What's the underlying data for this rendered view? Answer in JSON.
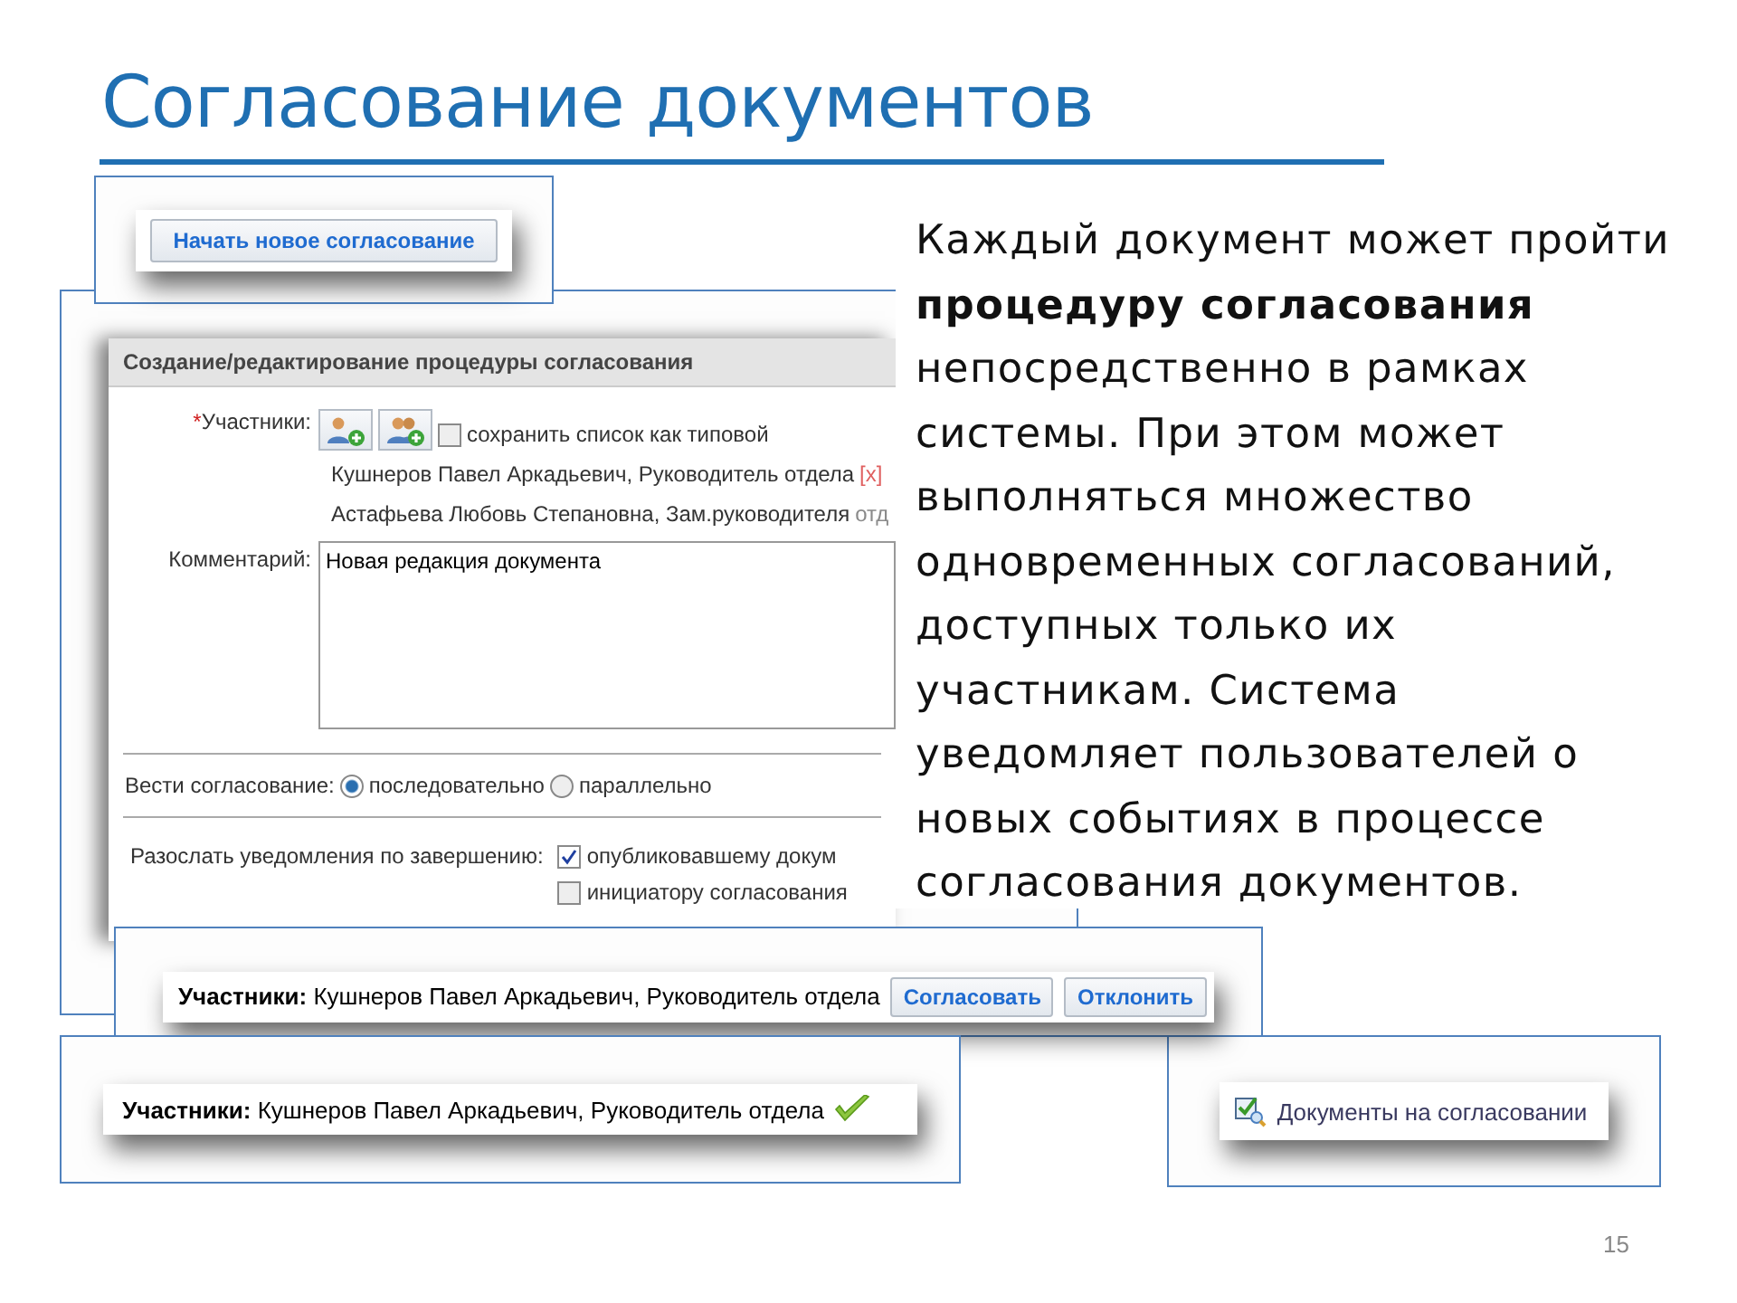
{
  "slide": {
    "title": "Согласование документов",
    "page_number": "15"
  },
  "start_panel": {
    "button": "Начать новое согласование"
  },
  "form": {
    "header": "Создание/редактирование процедуры согласования",
    "required_mark": "*",
    "participants_label": "Участники:",
    "save_checkbox": {
      "label": "сохранить список как типовой",
      "checked": false
    },
    "participants": [
      {
        "text": "Кушнеров Павел Аркадьевич, Руководитель отдела",
        "remove": "[x]"
      },
      {
        "text": "Астафьева Любовь Степановна, Зам.руководителя",
        "remove": "отд"
      }
    ],
    "comment_label": "Комментарий:",
    "comment_value": "Новая редакция документа",
    "mode_label": "Вести согласование:",
    "mode_options": [
      {
        "label": "последовательно",
        "selected": true
      },
      {
        "label": "параллельно",
        "selected": false
      }
    ],
    "notify_label": "Разослать уведомления по завершению:",
    "notify_options": [
      {
        "label": "опубликовавшему докум",
        "checked": true
      },
      {
        "label": "инициатору согласования",
        "checked": false
      }
    ]
  },
  "approval_bar": {
    "label": "Участники:",
    "text": "Кушнеров Павел Аркадьевич, Руководитель отдела",
    "buttons": [
      "Согласовать",
      "Отклонить"
    ]
  },
  "approved_bar": {
    "label": "Участники:",
    "text": "Кушнеров Павел Аркадьевич, Руководитель отдела",
    "approved": true
  },
  "menu_item": {
    "label": "Документы на согласовании"
  },
  "description": "Каждый документ может пройти **процедуру согласования** непосредственно в рамках системы. При этом может выполняться множество одновременных согласований, доступных только их участникам. Система уведомляет пользователей о новых событиях в процессе согласования документов."
}
